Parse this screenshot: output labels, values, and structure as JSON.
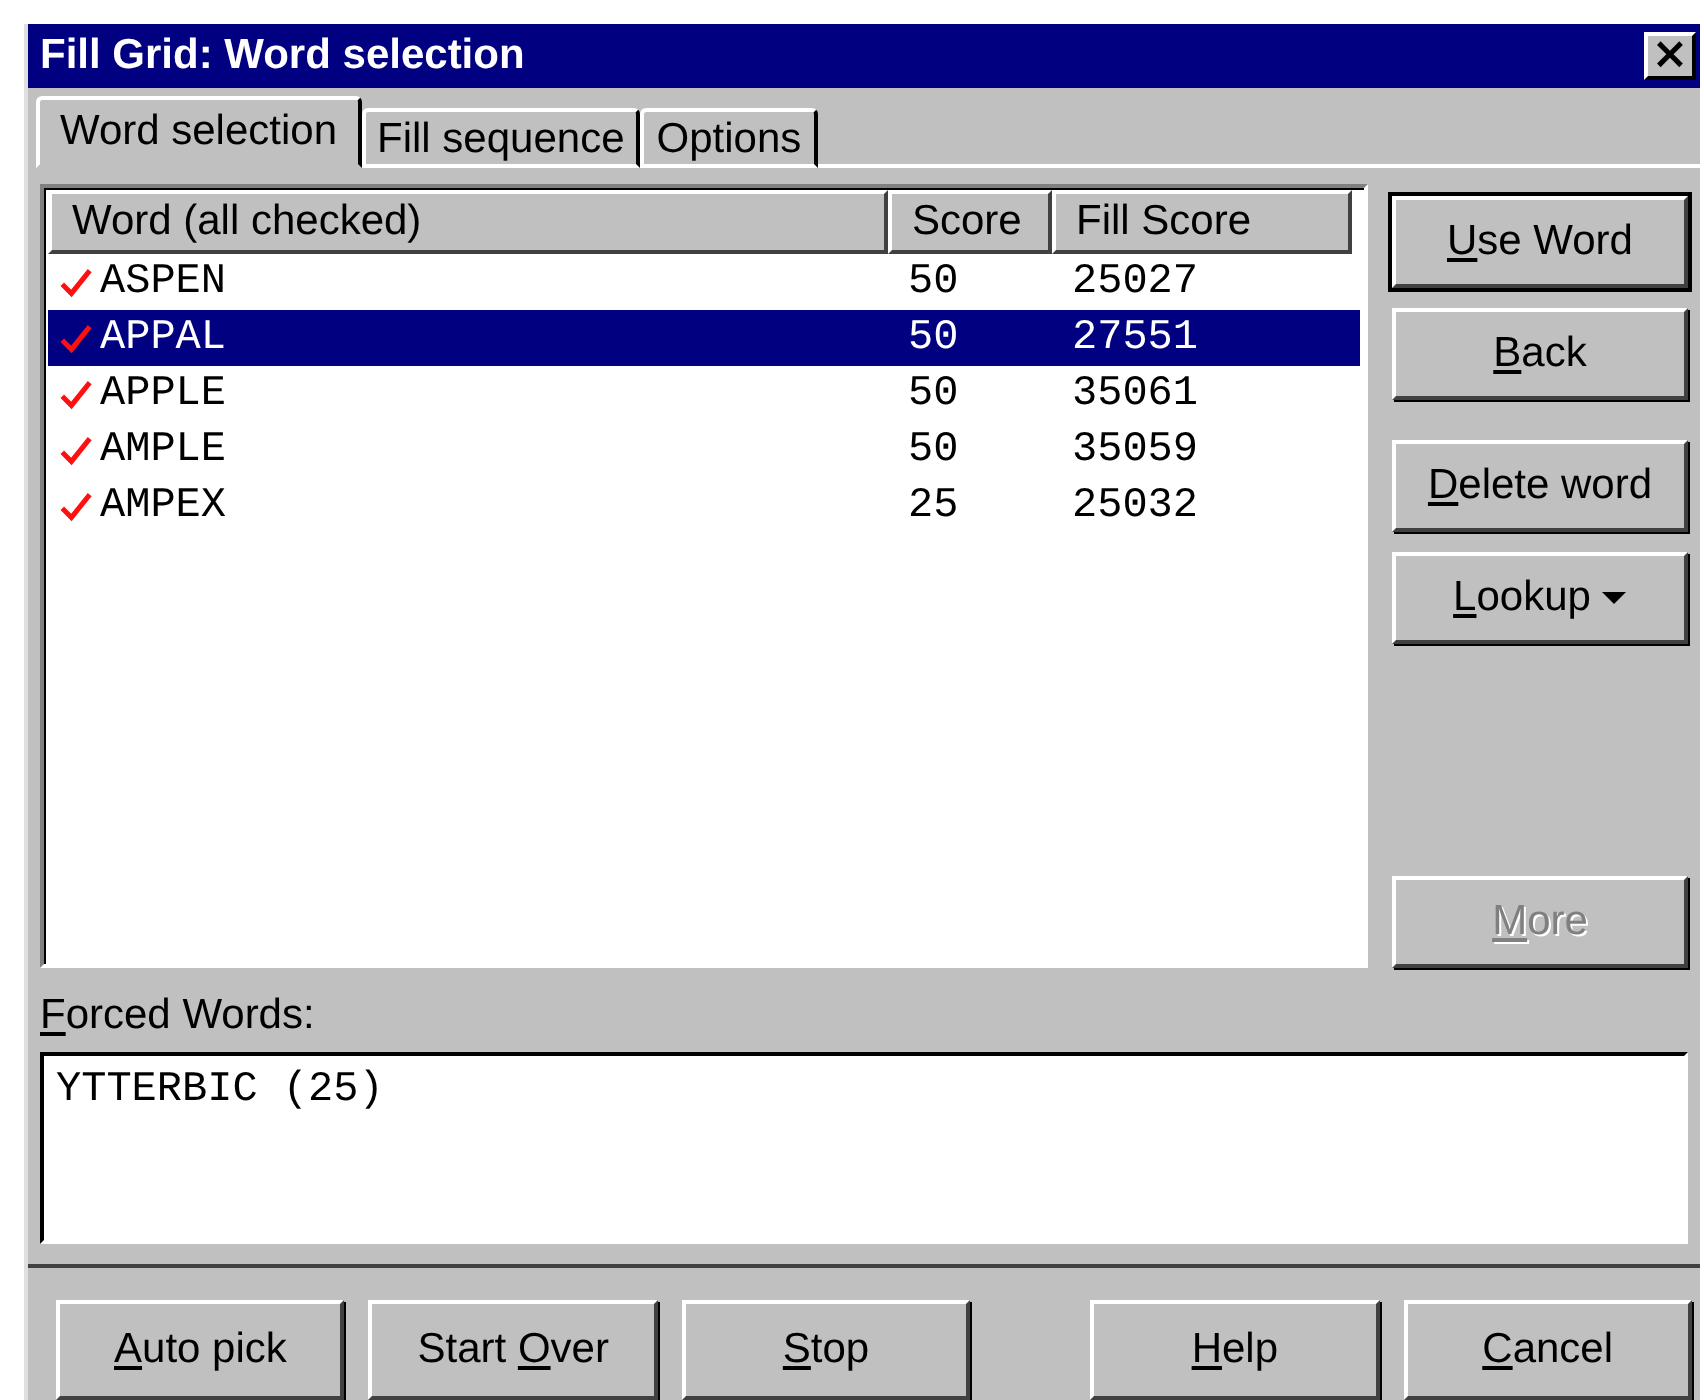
{
  "window": {
    "title": "Fill Grid: Word selection",
    "close": "×"
  },
  "tabs": [
    {
      "label": "Word selection",
      "selected": true
    },
    {
      "label": "Fill sequence",
      "selected": false
    },
    {
      "label": "Options",
      "selected": false
    }
  ],
  "word_list": {
    "columns": [
      "Word (all checked)",
      "Score",
      "Fill Score"
    ],
    "rows": [
      {
        "word": "ASPEN",
        "score": "50",
        "fill_score": "25027",
        "checked": true,
        "selected": false
      },
      {
        "word": "APPAL",
        "score": "50",
        "fill_score": "27551",
        "checked": true,
        "selected": true
      },
      {
        "word": "APPLE",
        "score": "50",
        "fill_score": "35061",
        "checked": true,
        "selected": false
      },
      {
        "word": "AMPLE",
        "score": "50",
        "fill_score": "35059",
        "checked": true,
        "selected": false
      },
      {
        "word": "AMPEX",
        "score": "25",
        "fill_score": "25032",
        "checked": true,
        "selected": false
      }
    ]
  },
  "side_buttons": [
    {
      "key": "U",
      "post": "se Word",
      "default": true,
      "disabled": false,
      "kind": "plain"
    },
    {
      "key": "B",
      "post": "ack",
      "default": false,
      "disabled": false,
      "kind": "plain"
    },
    {
      "key": "D",
      "post": "elete word",
      "default": false,
      "disabled": false,
      "kind": "plain"
    },
    {
      "key": "L",
      "post": "ookup",
      "default": false,
      "disabled": false,
      "kind": "menu"
    },
    {
      "key": "M",
      "post": "ore",
      "default": false,
      "disabled": true,
      "kind": "plain"
    }
  ],
  "forced_words": {
    "label": {
      "key": "F",
      "post": "orced Words:"
    },
    "value": "YTTERBIC (25)"
  },
  "bottom_buttons": [
    {
      "key": "A",
      "post": "uto pick"
    },
    {
      "pre": "Start ",
      "key": "O",
      "post": "ver"
    },
    {
      "key": "S",
      "post": "top"
    },
    {
      "key": "H",
      "post": "elp"
    },
    {
      "key": "C",
      "post": "ancel"
    }
  ]
}
